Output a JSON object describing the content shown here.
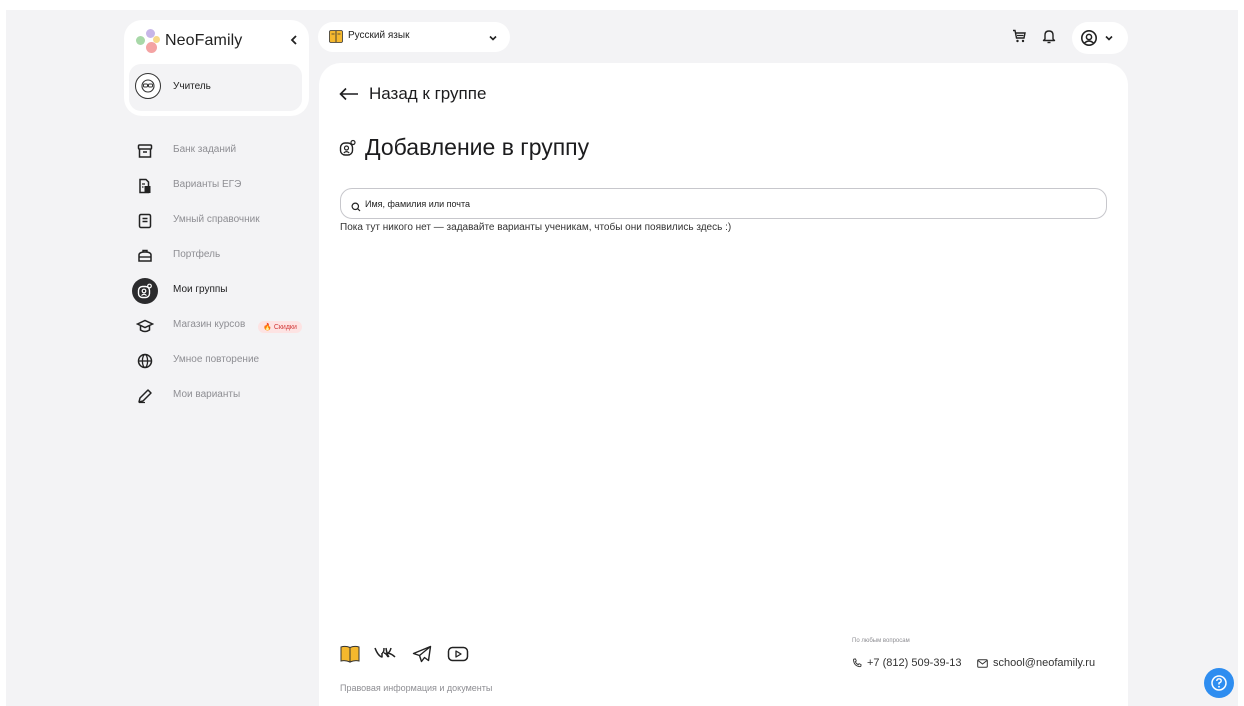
{
  "brand": {
    "name": "NeoFamily",
    "collapse_icon": "chevron-left-icon"
  },
  "role": {
    "label": "Учитель",
    "icon": "teacher-avatar-icon"
  },
  "sidebar": {
    "items": [
      {
        "label": "Банк заданий",
        "icon": "archive-box-icon",
        "active": false
      },
      {
        "label": "Варианты ЕГЭ",
        "icon": "document-stack-icon",
        "active": false
      },
      {
        "label": "Умный справочник",
        "icon": "handbook-icon",
        "active": false
      },
      {
        "label": "Портфель",
        "icon": "briefcase-icon",
        "active": false
      },
      {
        "label": "Мои группы",
        "icon": "group-icon",
        "active": true
      },
      {
        "label": "Магазин курсов",
        "icon": "graduation-cap-icon",
        "active": false
      },
      {
        "label": "Умное повторение",
        "icon": "globe-icon",
        "active": false
      },
      {
        "label": "Мои варианты",
        "icon": "pencil-icon",
        "active": false
      }
    ],
    "sale_badge": "Скидки"
  },
  "topbar": {
    "subject": "Русский язык",
    "icons": [
      "cart-icon",
      "bell-icon",
      "user-circle-icon",
      "chevron-down-icon"
    ]
  },
  "main": {
    "back_label": "Назад к группе",
    "title": "Добавление в группу",
    "search_placeholder": "Имя, фамилия или почта",
    "empty_message": "Пока тут никого нет — задавайте варианты ученикам, чтобы они появились здесь :)"
  },
  "footer": {
    "social_icons": [
      "book-icon",
      "vk-icon",
      "telegram-icon",
      "youtube-icon"
    ],
    "legal_link": "Правовая информация и документы",
    "contact_caption": "По любым вопросам",
    "phone": "+7 (812) 509-39-13",
    "email": "school@neofamily.ru"
  },
  "colors": {
    "background": "#f3f3f5",
    "active_nav": "#2b2b2d",
    "help_button": "#2e8df0",
    "sale": "#d23a3a"
  }
}
